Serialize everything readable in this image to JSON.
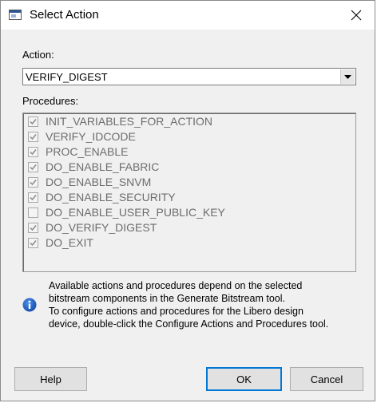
{
  "window": {
    "title": "Select Action"
  },
  "action": {
    "label": "Action:",
    "selected": "VERIFY_DIGEST"
  },
  "procedures": {
    "label": "Procedures:",
    "items": [
      {
        "name": "INIT_VARIABLES_FOR_ACTION",
        "checked": true
      },
      {
        "name": "VERIFY_IDCODE",
        "checked": true
      },
      {
        "name": "PROC_ENABLE",
        "checked": true
      },
      {
        "name": "DO_ENABLE_FABRIC",
        "checked": true
      },
      {
        "name": "DO_ENABLE_SNVM",
        "checked": true
      },
      {
        "name": "DO_ENABLE_SECURITY",
        "checked": true
      },
      {
        "name": "DO_ENABLE_USER_PUBLIC_KEY",
        "checked": false
      },
      {
        "name": "DO_VERIFY_DIGEST",
        "checked": true
      },
      {
        "name": "DO_EXIT",
        "checked": true
      }
    ]
  },
  "info": {
    "icon": "info-icon",
    "lines": [
      "Available actions and procedures depend on the selected",
      "bitstream components in the Generate Bitstream tool.",
      "To configure actions and procedures for the Libero design",
      "device, double-click the Configure Actions and Procedures tool."
    ]
  },
  "buttons": {
    "help": "Help",
    "ok": "OK",
    "cancel": "Cancel"
  }
}
